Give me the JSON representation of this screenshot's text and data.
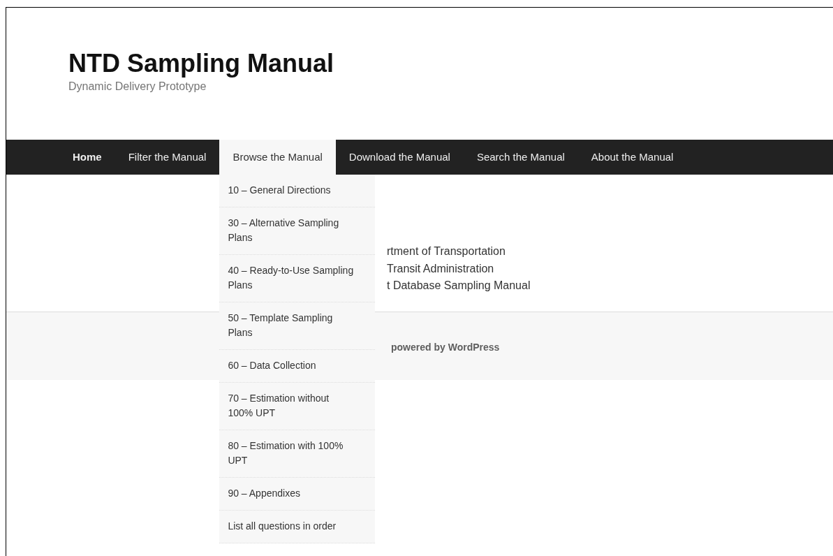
{
  "site": {
    "title": "NTD Sampling Manual",
    "tagline": "Dynamic Delivery Prototype"
  },
  "nav": [
    {
      "label": "Home",
      "current": true,
      "selected": false
    },
    {
      "label": "Filter the Manual",
      "current": false,
      "selected": false
    },
    {
      "label": "Browse the Manual",
      "current": false,
      "selected": true
    },
    {
      "label": "Download the Manual",
      "current": false,
      "selected": false
    },
    {
      "label": "Search the Manual",
      "current": false,
      "selected": false
    },
    {
      "label": "About the Manual",
      "current": false,
      "selected": false
    }
  ],
  "dropdown": {
    "items": [
      "10 – General Directions",
      "30 – Alternative Sampling Plans",
      "40 – Ready-to-Use Sampling Plans",
      "50 – Template Sampling Plans",
      "60 – Data Collection",
      "70 – Estimation without 100% UPT",
      "80 – Estimation with 100% UPT",
      "90 – Appendixes",
      "List all questions in order"
    ]
  },
  "content": {
    "lines": [
      "rtment of Transportation",
      "Transit Administration",
      "t Database Sampling Manual"
    ]
  },
  "footer": {
    "credit": "powered by WordPress"
  }
}
